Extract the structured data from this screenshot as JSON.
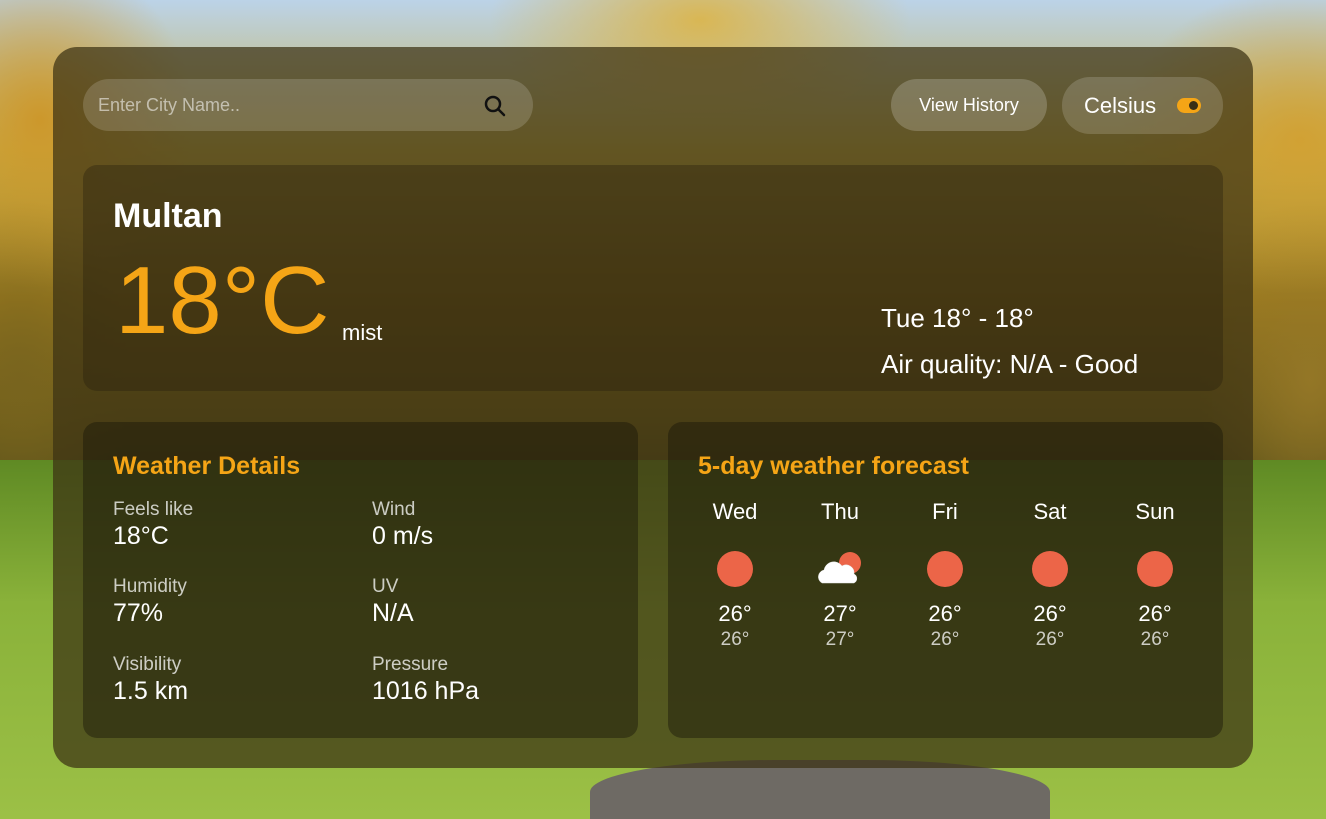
{
  "search": {
    "placeholder": "Enter City Name.."
  },
  "header": {
    "history_label": "View History",
    "unit_label": "Celsius"
  },
  "current": {
    "city": "Multan",
    "temperature": "18°C",
    "description": "mist",
    "range": "Tue 18° - 18°",
    "air_quality": "Air quality: N/A - Good"
  },
  "details": {
    "title": "Weather Details",
    "items": [
      {
        "label": "Feels like",
        "value": "18°C"
      },
      {
        "label": "Wind",
        "value": "0 m/s"
      },
      {
        "label": "Humidity",
        "value": "77%"
      },
      {
        "label": "UV",
        "value": "N/A"
      },
      {
        "label": "Visibility",
        "value": "1.5 km"
      },
      {
        "label": "Pressure",
        "value": "1016 hPa"
      }
    ]
  },
  "forecast": {
    "title": "5-day weather forecast",
    "days": [
      {
        "day": "Wed",
        "icon": "sun-icon",
        "high": "26°",
        "low": "26°"
      },
      {
        "day": "Thu",
        "icon": "partly-cloudy-icon",
        "high": "27°",
        "low": "27°"
      },
      {
        "day": "Fri",
        "icon": "sun-icon",
        "high": "26°",
        "low": "26°"
      },
      {
        "day": "Sat",
        "icon": "sun-icon",
        "high": "26°",
        "low": "26°"
      },
      {
        "day": "Sun",
        "icon": "sun-icon",
        "high": "26°",
        "low": "26°"
      }
    ]
  },
  "colors": {
    "accent": "#f5a516",
    "sun": "#ec6548",
    "cloud": "#ffffff"
  }
}
